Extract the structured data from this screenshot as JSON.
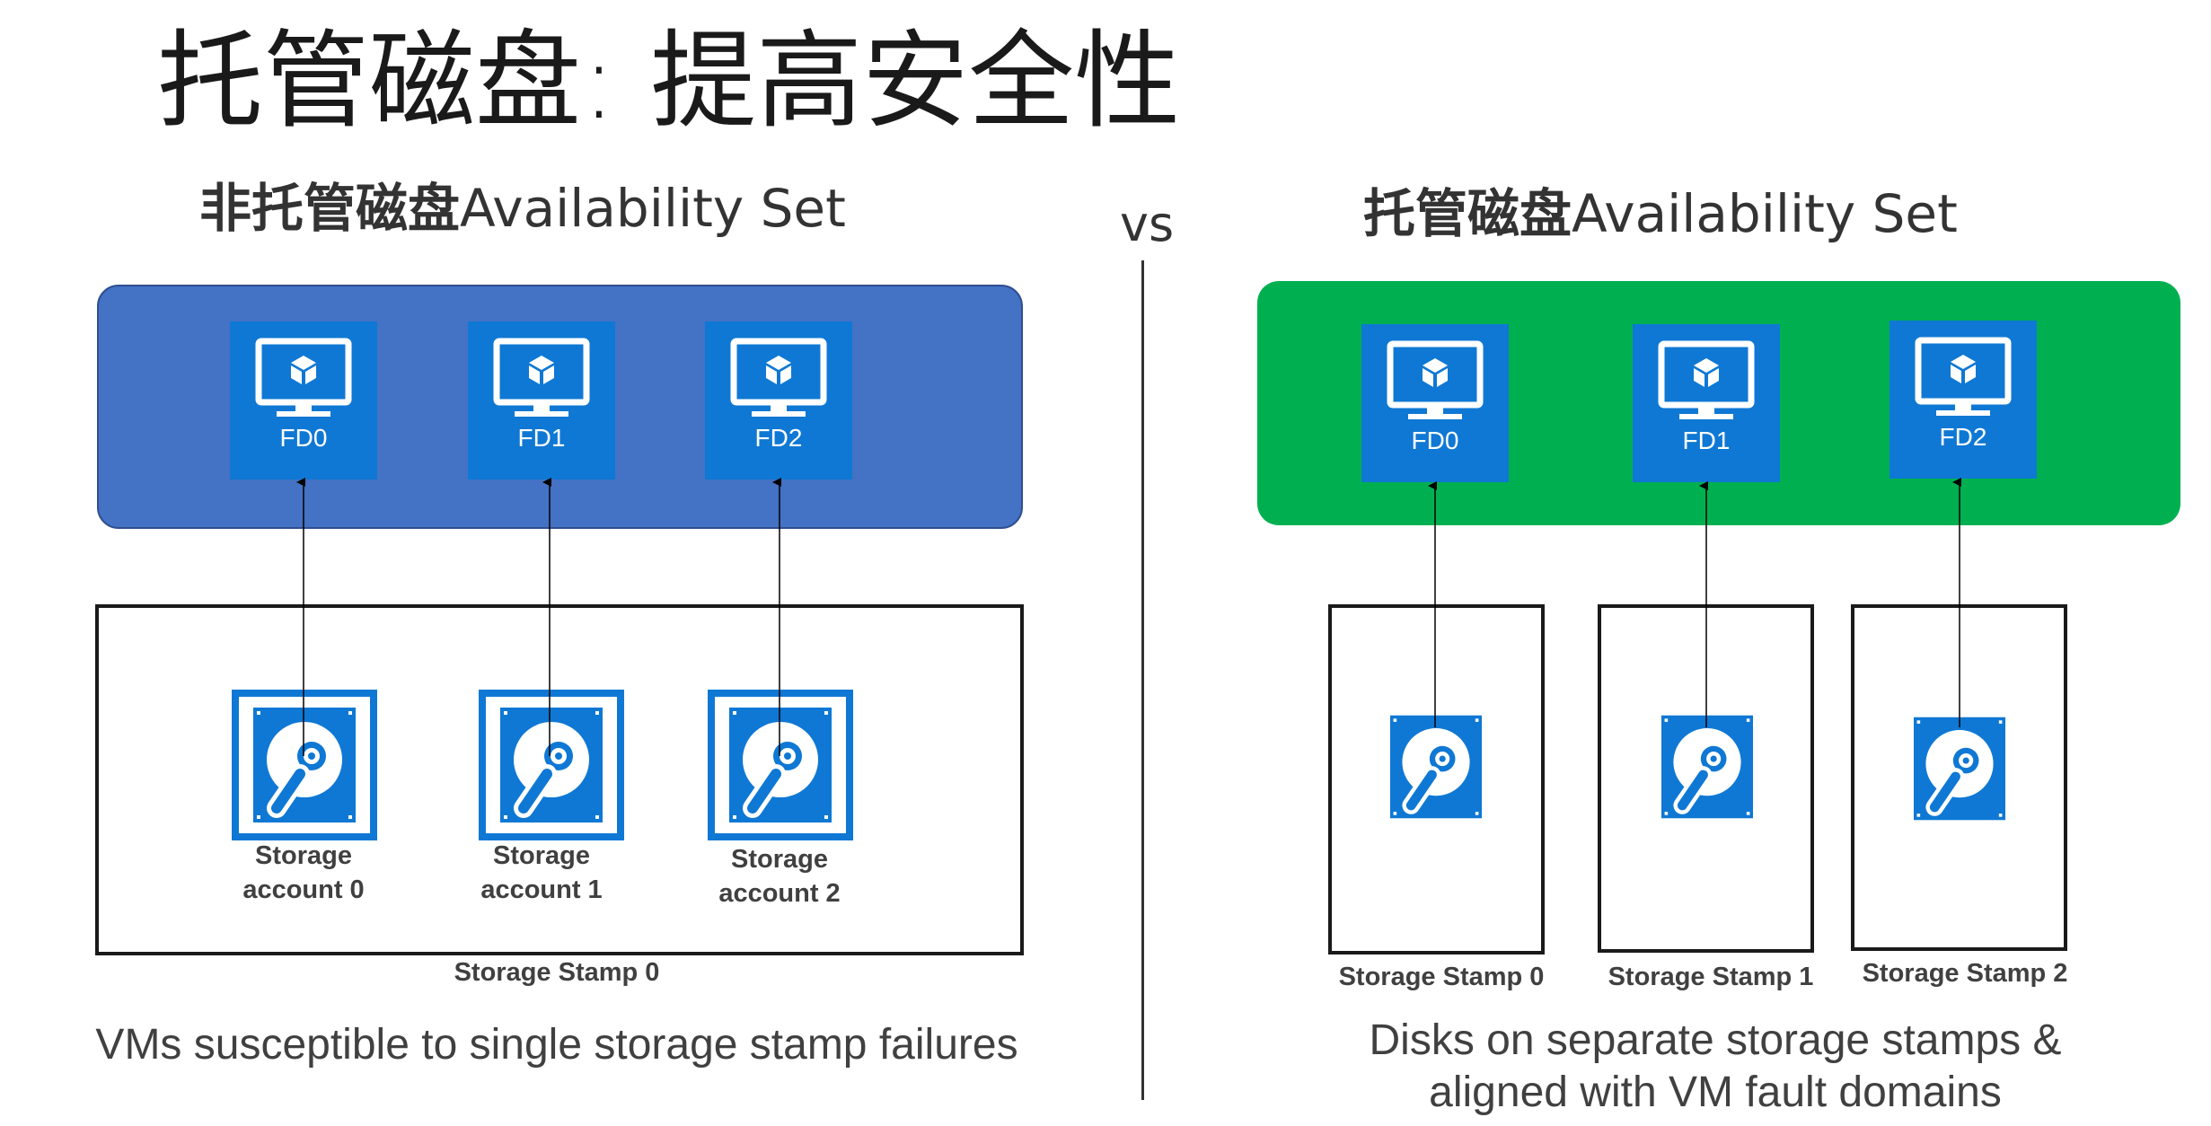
{
  "title": "托管磁盘: 提高安全性",
  "vs": "vs",
  "left": {
    "heading_bold": "非托管磁盘",
    "heading_rest": "Availability Set",
    "vms": [
      "FD0",
      "FD1",
      "FD2"
    ],
    "storage": [
      {
        "line1": "Storage",
        "line2": "account 0"
      },
      {
        "line1": "Storage",
        "line2": "account 1"
      },
      {
        "line1": "Storage",
        "line2": "account 2"
      }
    ],
    "stamp_label": "Storage Stamp 0",
    "caption": "VMs susceptible to single storage stamp failures",
    "panel_color": "#4472c4"
  },
  "right": {
    "heading_bold": "托管磁盘",
    "heading_rest": "Availability Set",
    "vms": [
      "FD0",
      "FD1",
      "FD2"
    ],
    "stamps": [
      "Storage Stamp 0",
      "Storage Stamp 1",
      "Storage Stamp 2"
    ],
    "caption_line1": "Disks on separate storage stamps &",
    "caption_line2": "aligned with VM fault domains",
    "panel_color": "#00b050"
  },
  "colors": {
    "icon_blue": "#0f78d4"
  },
  "icons": {
    "vm": "vm-monitor-icon",
    "disk": "hard-disk-icon"
  }
}
